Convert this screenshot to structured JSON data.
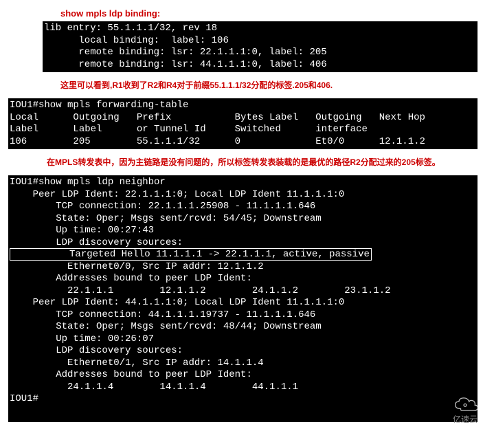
{
  "title1": "show mpls ldp binding:",
  "term1": "lib entry: 55.1.1.1/32, rev 18\n      local binding:  label: 106\n      remote binding: lsr: 22.1.1.1:0, label: 205\n      remote binding: lsr: 44.1.1.1:0, label: 406",
  "note1": "这里可以看到,R1收到了R2和R4对于前缀55.1.1.1/32分配的标签.205和406.",
  "term2": {
    "cmd": "IOU1#show mpls forwarding-table",
    "hdr": "Local      Outgoing   Prefix           Bytes Label   Outgoing   Next Hop\nLabel      Label      or Tunnel Id     Switched      interface",
    "row": "106        205        55.1.1.1/32      0             Et0/0      12.1.1.2"
  },
  "note2": "在MPLS转发表中，因为主链路是没有问题的，所以标签转发表装载的是最优的路径R2分配过来的205标签。",
  "term3": {
    "cmd": "IOU1#show mpls ldp neighbor",
    "p1a": "    Peer LDP Ident: 22.1.1.1:0; Local LDP Ident 11.1.1.1:0\n        TCP connection: 22.1.1.1.25908 - 11.1.1.1.646\n        State: Oper; Msgs sent/rcvd: 54/45; Downstream\n        Up time: 00:27:43\n        LDP discovery sources:",
    "hl": "          Targeted Hello 11.1.1.1 -> 22.1.1.1, active, passive",
    "p1b": "          Ethernet0/0, Src IP addr: 12.1.1.2\n        Addresses bound to peer LDP Ident:\n          22.1.1.1        12.1.1.2        24.1.1.2        23.1.1.2",
    "p2": "    Peer LDP Ident: 44.1.1.1:0; Local LDP Ident 11.1.1.1:0\n        TCP connection: 44.1.1.1.19737 - 11.1.1.1.646\n        State: Oper; Msgs sent/rcvd: 48/44; Downstream\n        Up time: 00:26:07\n        LDP discovery sources:\n          Ethernet0/1, Src IP addr: 14.1.1.4\n        Addresses bound to peer LDP Ident:\n          24.1.1.4        14.1.1.4        44.1.1.1",
    "prompt": "IOU1#"
  },
  "logo_text": "亿速云"
}
